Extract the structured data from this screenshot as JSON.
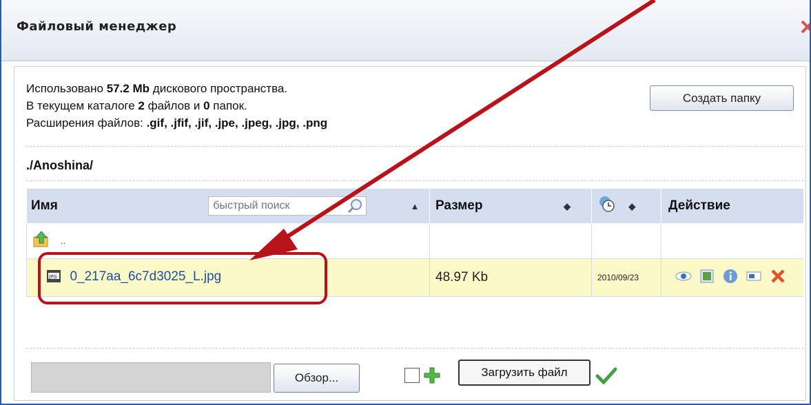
{
  "window": {
    "title": "Файловый менеджер"
  },
  "info": {
    "line1_pre": "Использовано ",
    "line1_value": "57.2 Mb",
    "line1_post": " дискового пространства.",
    "line2_pre": "В текущем каталоге ",
    "line2_files": "2",
    "line2_mid": " файлов и ",
    "line2_dirs": "0",
    "line2_post": " папок.",
    "line3_pre": "Расширения файлов: ",
    "line3_exts": ".gif, .jfif, .jif, .jpe, .jpeg, .jpg, .png"
  },
  "buttons": {
    "create_folder": "Создать папку",
    "browse": "Обзор...",
    "upload": "Загрузить файл"
  },
  "path": "./Anoshina/",
  "table": {
    "col_name": "Имя",
    "search_placeholder": "быстрый поиск",
    "col_size": "Размер",
    "col_action": "Действие",
    "parent_row": {
      "label": ".."
    },
    "rows": [
      {
        "name": "0_217aa_6c7d3025_L.jpg",
        "size": "48.97 Kb",
        "date": "2010/09/23"
      }
    ]
  },
  "icons": {
    "close": "close-icon",
    "search": "magnifier-icon",
    "clock": "clock-icon",
    "up": "folder-up-icon",
    "file": "jpg-file-icon",
    "view": "eye-icon",
    "thumb": "thumbnail-icon",
    "info": "info-icon",
    "rename": "rename-icon",
    "delete": "delete-icon",
    "plus": "plus-icon",
    "ok": "checkmark-icon"
  },
  "colors": {
    "header_bg": "#d4deef",
    "selected_row": "#fbf9c7",
    "annotation": "#b8131b",
    "link": "#1f4f9b"
  }
}
